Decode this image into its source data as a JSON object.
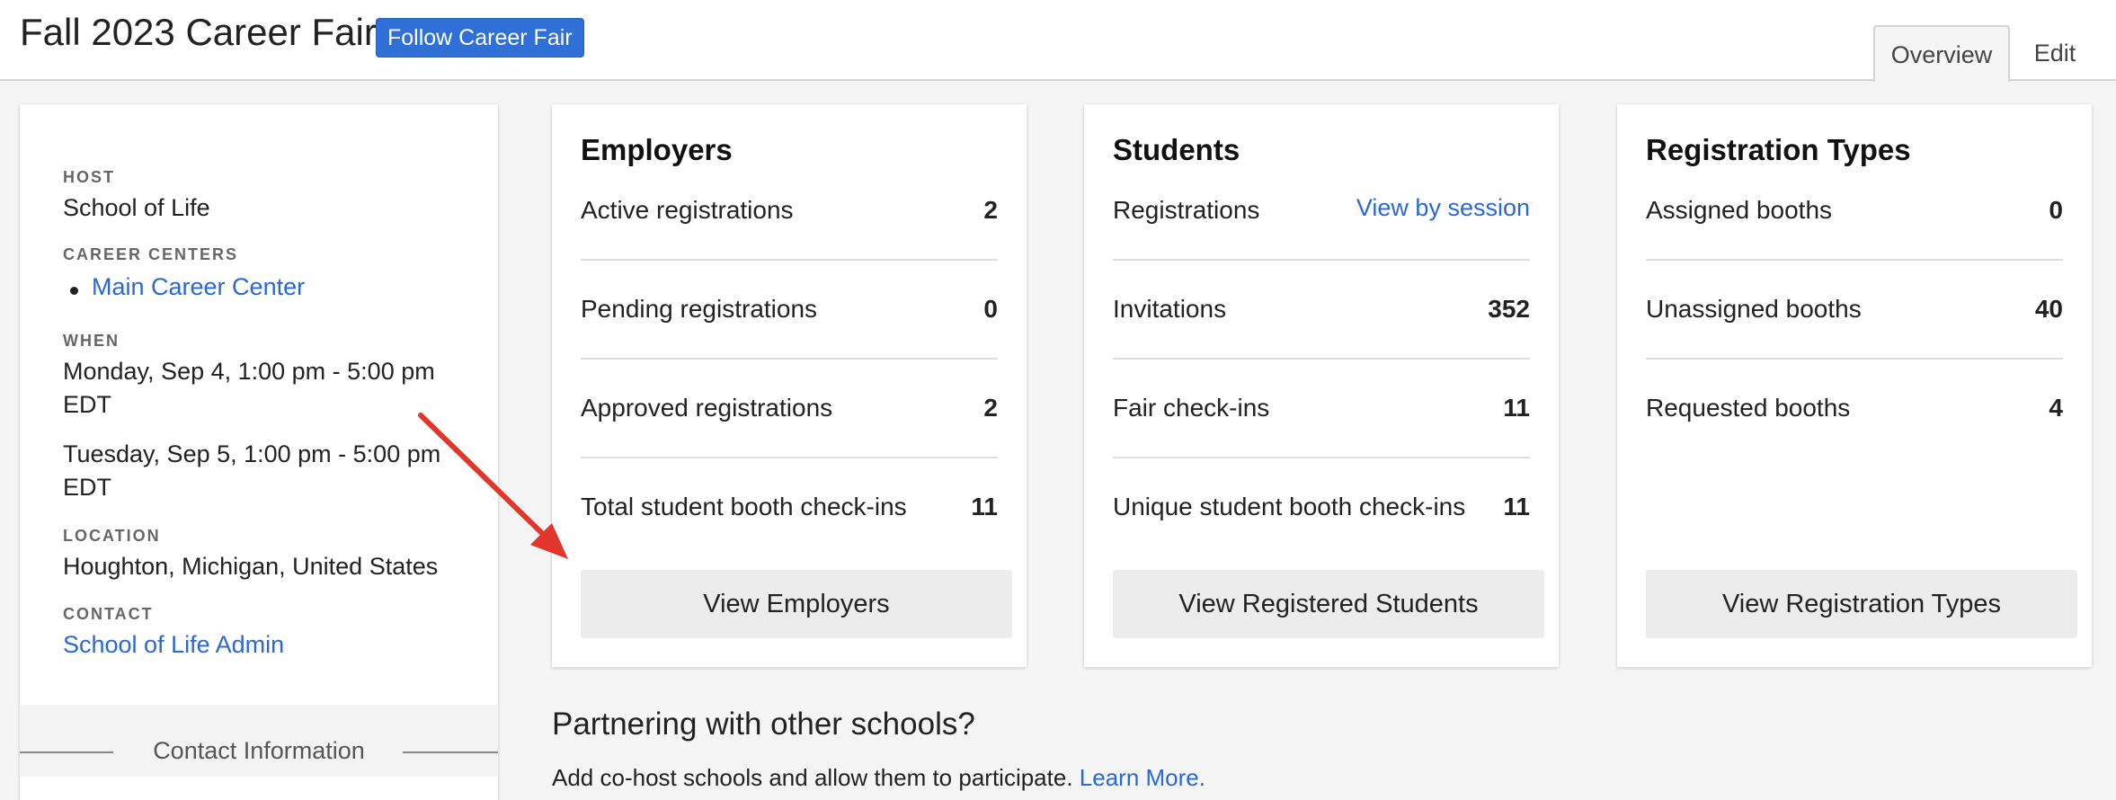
{
  "header": {
    "title": "Fall 2023 Career Fair",
    "follow_label": "Follow Career Fair",
    "tabs": [
      {
        "label": "Overview",
        "active": true
      },
      {
        "label": "Edit",
        "active": false
      }
    ]
  },
  "sidebar": {
    "host_label": "HOST",
    "host_value": "School of Life",
    "career_centers_label": "CAREER CENTERS",
    "career_centers": [
      "Main Career Center"
    ],
    "when_label": "WHEN",
    "sessions": [
      {
        "line1": "Monday, Sep 4, 1:00 pm - 5:00 pm",
        "line2": "EDT"
      },
      {
        "line1": "Tuesday, Sep 5, 1:00 pm - 5:00 pm",
        "line2": "EDT"
      }
    ],
    "location_label": "LOCATION",
    "location_value": "Houghton, Michigan, United States",
    "contact_label": "CONTACT",
    "contact_value": "School of Life Admin",
    "contact_section_title": "Contact Information"
  },
  "cards": {
    "employers": {
      "title": "Employers",
      "rows": [
        {
          "label": "Active registrations",
          "value": "2"
        },
        {
          "label": "Pending registrations",
          "value": "0"
        },
        {
          "label": "Approved registrations",
          "value": "2"
        },
        {
          "label": "Total student booth check-ins",
          "value": "11"
        }
      ],
      "button": "View Employers"
    },
    "students": {
      "title": "Students",
      "rows": [
        {
          "label": "Registrations",
          "link": "View by session"
        },
        {
          "label": "Invitations",
          "value": "352"
        },
        {
          "label": "Fair check-ins",
          "value": "11"
        },
        {
          "label": "Unique student booth check-ins",
          "value": "11"
        }
      ],
      "button": "View Registered Students"
    },
    "registration_types": {
      "title": "Registration Types",
      "rows": [
        {
          "label": "Assigned booths",
          "value": "0"
        },
        {
          "label": "Unassigned booths",
          "value": "40"
        },
        {
          "label": "Requested booths",
          "value": "4"
        }
      ],
      "button": "View Registration Types"
    }
  },
  "partner": {
    "title": "Partnering with other schools?",
    "text": "Add co-host schools and allow them to participate.",
    "link": "Learn More."
  },
  "colors": {
    "link": "#2a68d4",
    "follow_button": "#2f6fd6",
    "annotation_arrow": "#e0362c"
  }
}
